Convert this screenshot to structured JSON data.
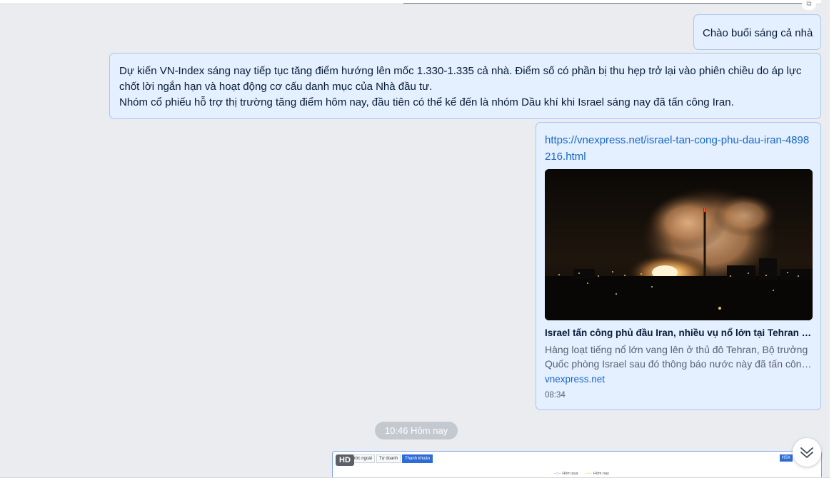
{
  "messages": {
    "greeting": "Chào buổi sáng cả nhà",
    "market_text": {
      "paragraph_1": "Dự kiến VN-Index sáng nay tiếp tục tăng điểm hướng lên mốc 1.330-1.335 cả nhà. Điểm số có phần bị thu hẹp trở lại vào phiên chiều do áp lực chốt lời ngắn hạn và hoạt động cơ cấu danh mục của Nhà đầu tư.",
      "paragraph_2": "Nhóm cổ phiếu hỗ trợ thị trường tăng điểm hôm nay, đầu tiên có thể kể đến là nhóm Dầu khí khi Israel sáng nay đã tấn công Iran."
    },
    "link_preview": {
      "url": "https://vnexpress.net/israel-tan-cong-phu-dau-iran-4898216.html",
      "title": "Israel tấn công phủ đầu Iran, nhiều vụ nổ lớn tại Tehran - VnExpress",
      "description_line_1": "Hàng loạt tiếng nổ lớn vang lên ở thủ đô Tehran, Bộ trưởng",
      "description_line_2": "Quốc phòng Israel sau đó thông báo nước này đã tấn công Iran",
      "domain": "vnexpress.net",
      "time": "08:34"
    }
  },
  "date_separator": "10:46 Hôm nay",
  "image_message": {
    "badge": "HD",
    "tabs": [
      "g",
      "Nước ngoài",
      "Tự doanh",
      "Thanh khoản"
    ],
    "active_tab": "Thanh khoản",
    "exchange_label": "HSX",
    "legend": [
      "Hôm qua",
      "Hôm nay"
    ]
  },
  "colors": {
    "bubble_bg": "#e4efff",
    "bubble_border": "#a8c6f0",
    "link": "#1668c9",
    "page_bg": "#eaecef"
  },
  "icons": {
    "scroll_down": "double-chevron-down-icon",
    "top_corner": "copy-icon"
  }
}
